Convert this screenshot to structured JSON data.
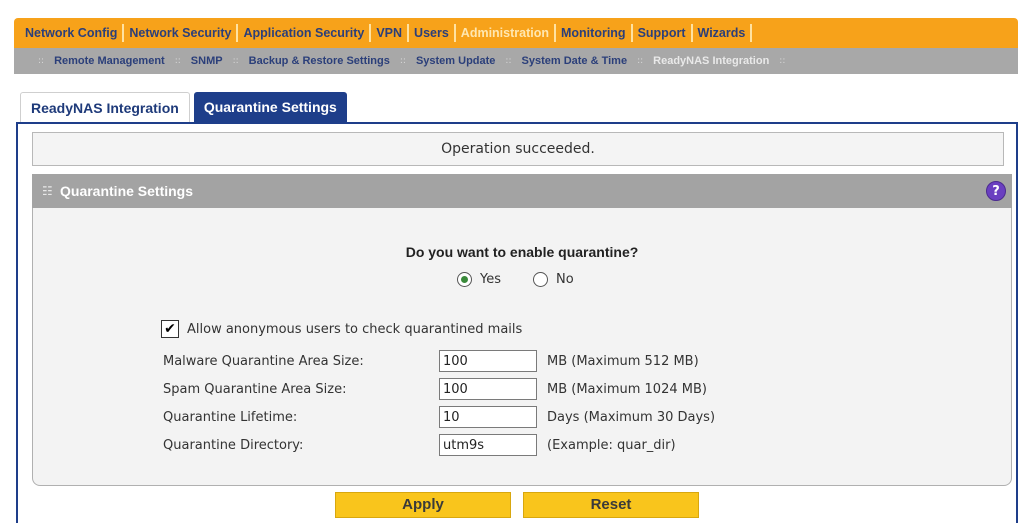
{
  "main_nav": [
    {
      "label": "Network Config",
      "active": false
    },
    {
      "label": "Network Security",
      "active": false
    },
    {
      "label": "Application Security",
      "active": false
    },
    {
      "label": "VPN",
      "active": false
    },
    {
      "label": "Users",
      "active": false
    },
    {
      "label": "Administration",
      "active": true
    },
    {
      "label": "Monitoring",
      "active": false
    },
    {
      "label": "Support",
      "active": false
    },
    {
      "label": "Wizards",
      "active": false
    }
  ],
  "sub_nav": [
    {
      "label": "Remote Management",
      "active": false
    },
    {
      "label": "SNMP",
      "active": false
    },
    {
      "label": "Backup & Restore Settings",
      "active": false
    },
    {
      "label": "System Update",
      "active": false
    },
    {
      "label": "System Date & Time",
      "active": false
    },
    {
      "label": "ReadyNAS Integration",
      "active": true
    }
  ],
  "tabs": [
    {
      "label": "ReadyNAS Integration",
      "active": false
    },
    {
      "label": "Quarantine Settings",
      "active": true
    }
  ],
  "status_message": "Operation succeeded.",
  "panel": {
    "title": "Quarantine Settings",
    "help_icon": "?",
    "question": "Do you want to enable quarantine?",
    "radio_yes": "Yes",
    "radio_no": "No",
    "selected": "Yes",
    "checkbox_label": "Allow anonymous users to check quarantined mails",
    "checkbox_checked": true,
    "checkbox_mark": "✔",
    "fields": [
      {
        "label": "Malware Quarantine Area Size:",
        "value": "100",
        "hint": "MB (Maximum 512 MB)"
      },
      {
        "label": "Spam Quarantine Area Size:",
        "value": "100",
        "hint": "MB (Maximum 1024 MB)"
      },
      {
        "label": "Quarantine Lifetime:",
        "value": "10",
        "hint": "Days (Maximum 30 Days)"
      },
      {
        "label": "Quarantine Directory:",
        "value": "utm9s",
        "hint": "(Example: quar_dir)"
      }
    ]
  },
  "buttons": {
    "apply": "Apply",
    "reset": "Reset"
  },
  "colors": {
    "nav_orange": "#f7a21a",
    "nav_text": "#2b3f7a",
    "tab_active_bg": "#1e3e8a",
    "panel_header": "#a3a3a3",
    "button_yellow": "#f9c51c"
  }
}
